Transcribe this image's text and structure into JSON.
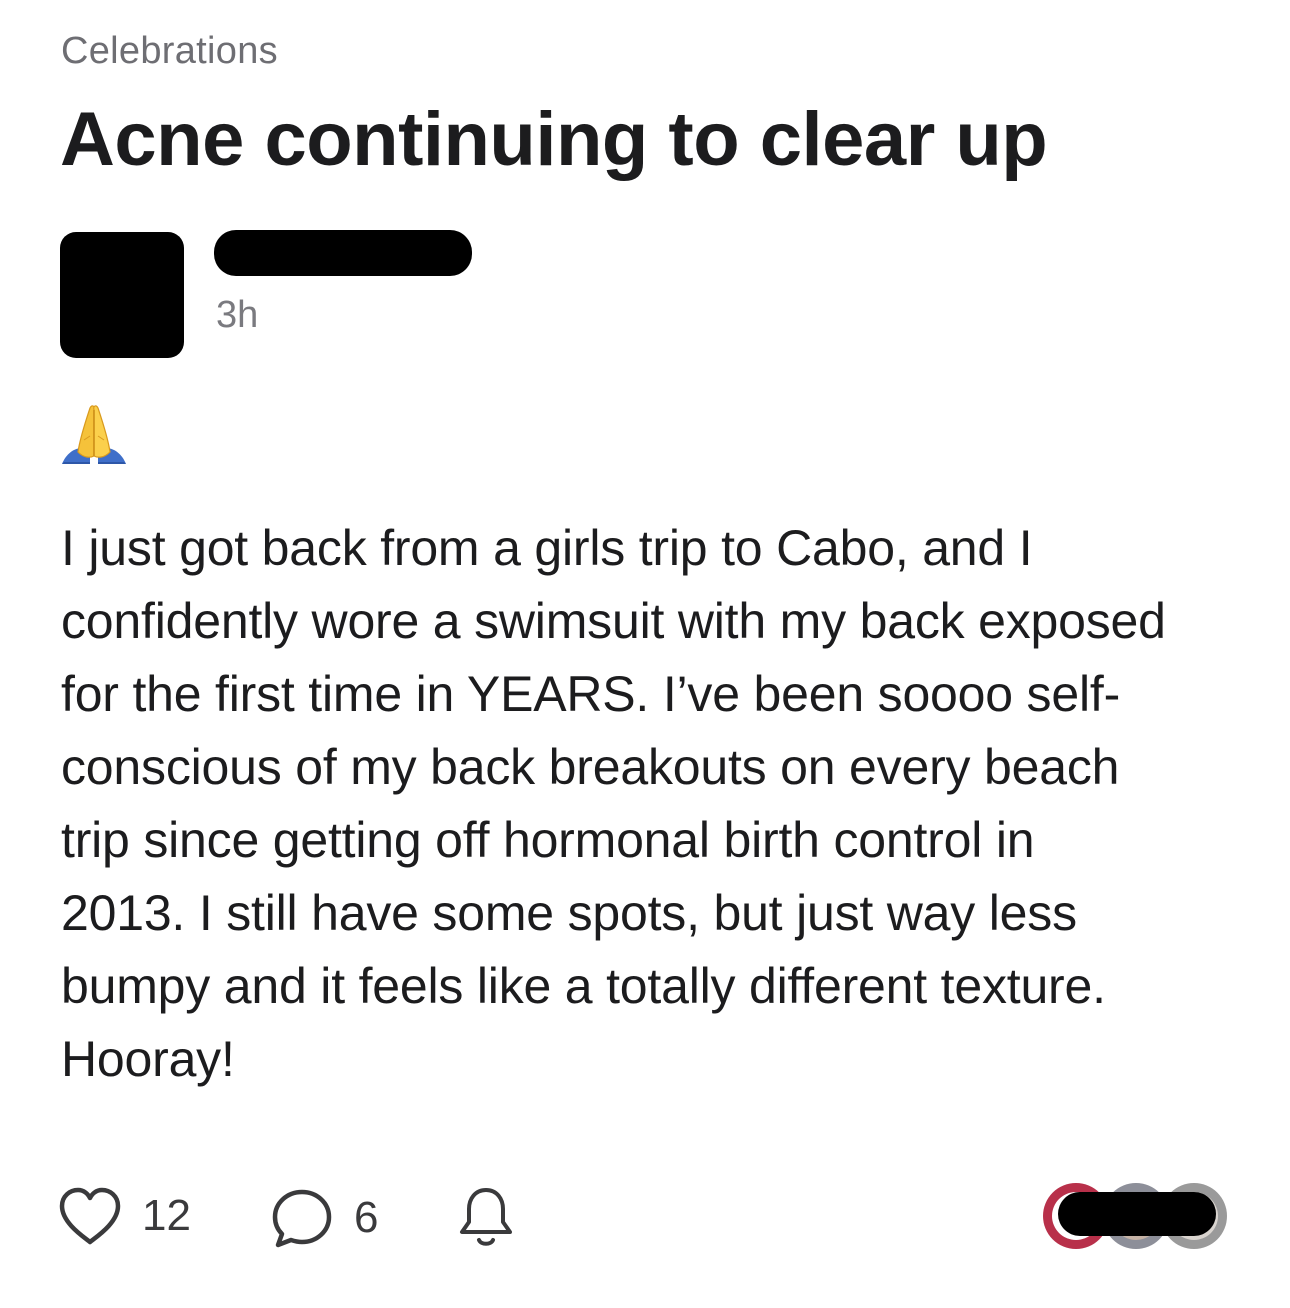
{
  "post": {
    "category": "Celebrations",
    "title": "Acne continuing to clear up",
    "timestamp": "3h",
    "emoji_icon": "folded-hands-icon",
    "body_lines": [
      "I just got back from a girls trip to Cabo, and I",
      "confidently wore a swimsuit with my back exposed",
      "for the first time in YEARS. I’ve been soooo self-",
      "conscious of my back breakouts on every beach",
      "trip since getting off hormonal birth control in",
      "2013. I still have some spots, but just way less",
      "bumpy and it feels like a totally different texture.",
      "Hooray!"
    ]
  },
  "actions": {
    "likes": "12",
    "comments": "6",
    "like_icon": "heart-icon",
    "comment_icon": "speech-bubble-icon",
    "follow_icon": "bell-icon"
  },
  "colors": {
    "text_primary": "#1c1c1e",
    "text_secondary": "#6e6e73",
    "redaction": "#000000",
    "participant_accent": "#b8304a"
  }
}
